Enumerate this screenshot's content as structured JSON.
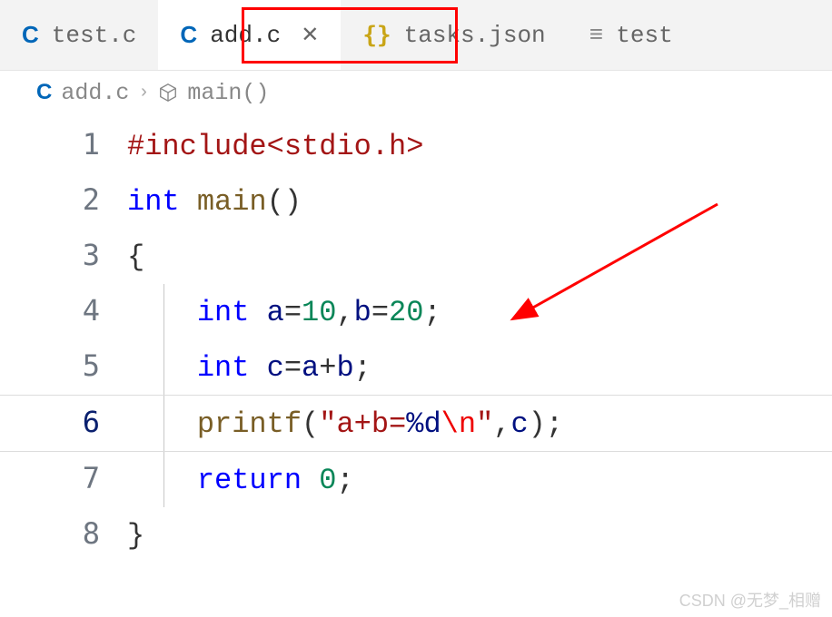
{
  "tabs": [
    {
      "icon": "C",
      "label": "test.c",
      "active": false,
      "closable": false
    },
    {
      "icon": "C",
      "label": "add.c",
      "active": true,
      "closable": true
    },
    {
      "icon": "{}",
      "label": "tasks.json",
      "active": false,
      "closable": false
    },
    {
      "icon": "≡",
      "label": "test",
      "active": false,
      "closable": false
    }
  ],
  "breadcrumb": {
    "file_icon": "C",
    "file": "add.c",
    "symbol": "main()"
  },
  "close_glyph": "✕",
  "chevron_glyph": "›",
  "code_lines": [
    {
      "n": "1",
      "tokens": [
        {
          "t": "#include",
          "c": "tok-directive"
        },
        {
          "t": "<stdio.h>",
          "c": "tok-include"
        }
      ]
    },
    {
      "n": "2",
      "tokens": [
        {
          "t": "int",
          "c": "tok-keyword"
        },
        {
          "t": " ",
          "c": ""
        },
        {
          "t": "main",
          "c": "tok-func"
        },
        {
          "t": "()",
          "c": "tok-punct"
        }
      ]
    },
    {
      "n": "3",
      "tokens": [
        {
          "t": "{",
          "c": "tok-brace"
        }
      ]
    },
    {
      "n": "4",
      "indent": true,
      "tokens": [
        {
          "t": "    ",
          "c": ""
        },
        {
          "t": "int",
          "c": "tok-keyword"
        },
        {
          "t": " ",
          "c": ""
        },
        {
          "t": "a",
          "c": "tok-var"
        },
        {
          "t": "=",
          "c": "tok-punct"
        },
        {
          "t": "10",
          "c": "tok-number"
        },
        {
          "t": ",",
          "c": "tok-punct"
        },
        {
          "t": "b",
          "c": "tok-var"
        },
        {
          "t": "=",
          "c": "tok-punct"
        },
        {
          "t": "20",
          "c": "tok-number"
        },
        {
          "t": ";",
          "c": "tok-punct"
        }
      ]
    },
    {
      "n": "5",
      "indent": true,
      "tokens": [
        {
          "t": "    ",
          "c": ""
        },
        {
          "t": "int",
          "c": "tok-keyword"
        },
        {
          "t": " ",
          "c": ""
        },
        {
          "t": "c",
          "c": "tok-var"
        },
        {
          "t": "=",
          "c": "tok-punct"
        },
        {
          "t": "a",
          "c": "tok-var"
        },
        {
          "t": "+",
          "c": "tok-punct"
        },
        {
          "t": "b",
          "c": "tok-var"
        },
        {
          "t": ";",
          "c": "tok-punct"
        }
      ]
    },
    {
      "n": "6",
      "indent": true,
      "active": true,
      "tokens": [
        {
          "t": "    ",
          "c": ""
        },
        {
          "t": "printf",
          "c": "tok-func"
        },
        {
          "t": "(",
          "c": "tok-punct"
        },
        {
          "t": "\"a+b=",
          "c": "tok-string"
        },
        {
          "t": "%d",
          "c": "tok-var"
        },
        {
          "t": "\\n",
          "c": "tok-escape"
        },
        {
          "t": "\"",
          "c": "tok-string"
        },
        {
          "t": ",",
          "c": "tok-punct"
        },
        {
          "t": "c",
          "c": "tok-var"
        },
        {
          "t": ")",
          "c": "tok-punct"
        },
        {
          "t": ";",
          "c": "tok-punct"
        }
      ]
    },
    {
      "n": "7",
      "indent": true,
      "tokens": [
        {
          "t": "    ",
          "c": ""
        },
        {
          "t": "return",
          "c": "tok-keyword"
        },
        {
          "t": " ",
          "c": ""
        },
        {
          "t": "0",
          "c": "tok-number"
        },
        {
          "t": ";",
          "c": "tok-punct"
        }
      ]
    },
    {
      "n": "8",
      "tokens": [
        {
          "t": "}",
          "c": "tok-brace"
        }
      ]
    }
  ],
  "watermark": "CSDN @无梦_相赠"
}
